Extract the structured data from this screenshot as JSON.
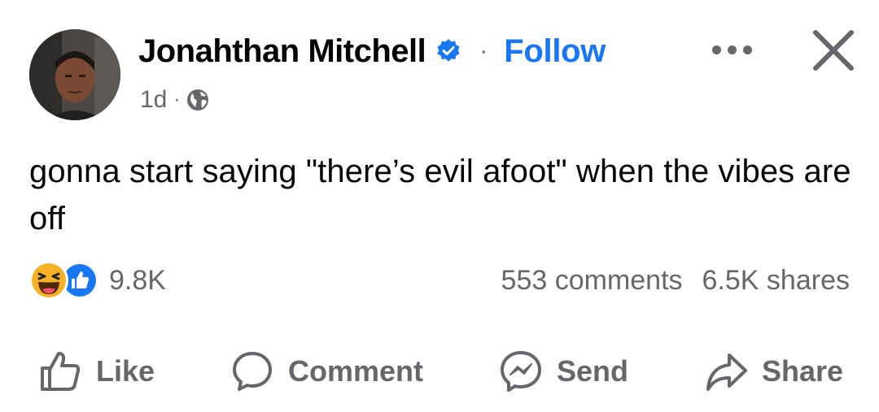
{
  "post": {
    "author": "Jonahthan Mitchell",
    "follow_label": "Follow",
    "separator": "·",
    "timestamp": "1d",
    "meta_separator": "·",
    "audience_icon": "globe-icon",
    "verified_icon": "verified-badge-icon",
    "text": "gonna start saying \"there’s evil afoot\" when the vibes are off"
  },
  "header": {
    "more_icon": "more-options-icon",
    "close_icon": "close-icon"
  },
  "stats": {
    "reactions": [
      "haha",
      "like"
    ],
    "reaction_count": "9.8K",
    "comments": "553 comments",
    "shares": "6.5K shares"
  },
  "actions": [
    {
      "label": "Like",
      "icon": "thumbs-up-icon"
    },
    {
      "label": "Comment",
      "icon": "comment-bubble-icon"
    },
    {
      "label": "Send",
      "icon": "messenger-icon"
    },
    {
      "label": "Share",
      "icon": "share-arrow-icon"
    }
  ],
  "colors": {
    "accent": "#1877f2",
    "secondary_text": "#65676b",
    "primary_text": "#050505",
    "haha_yellow": "#f7b125"
  }
}
